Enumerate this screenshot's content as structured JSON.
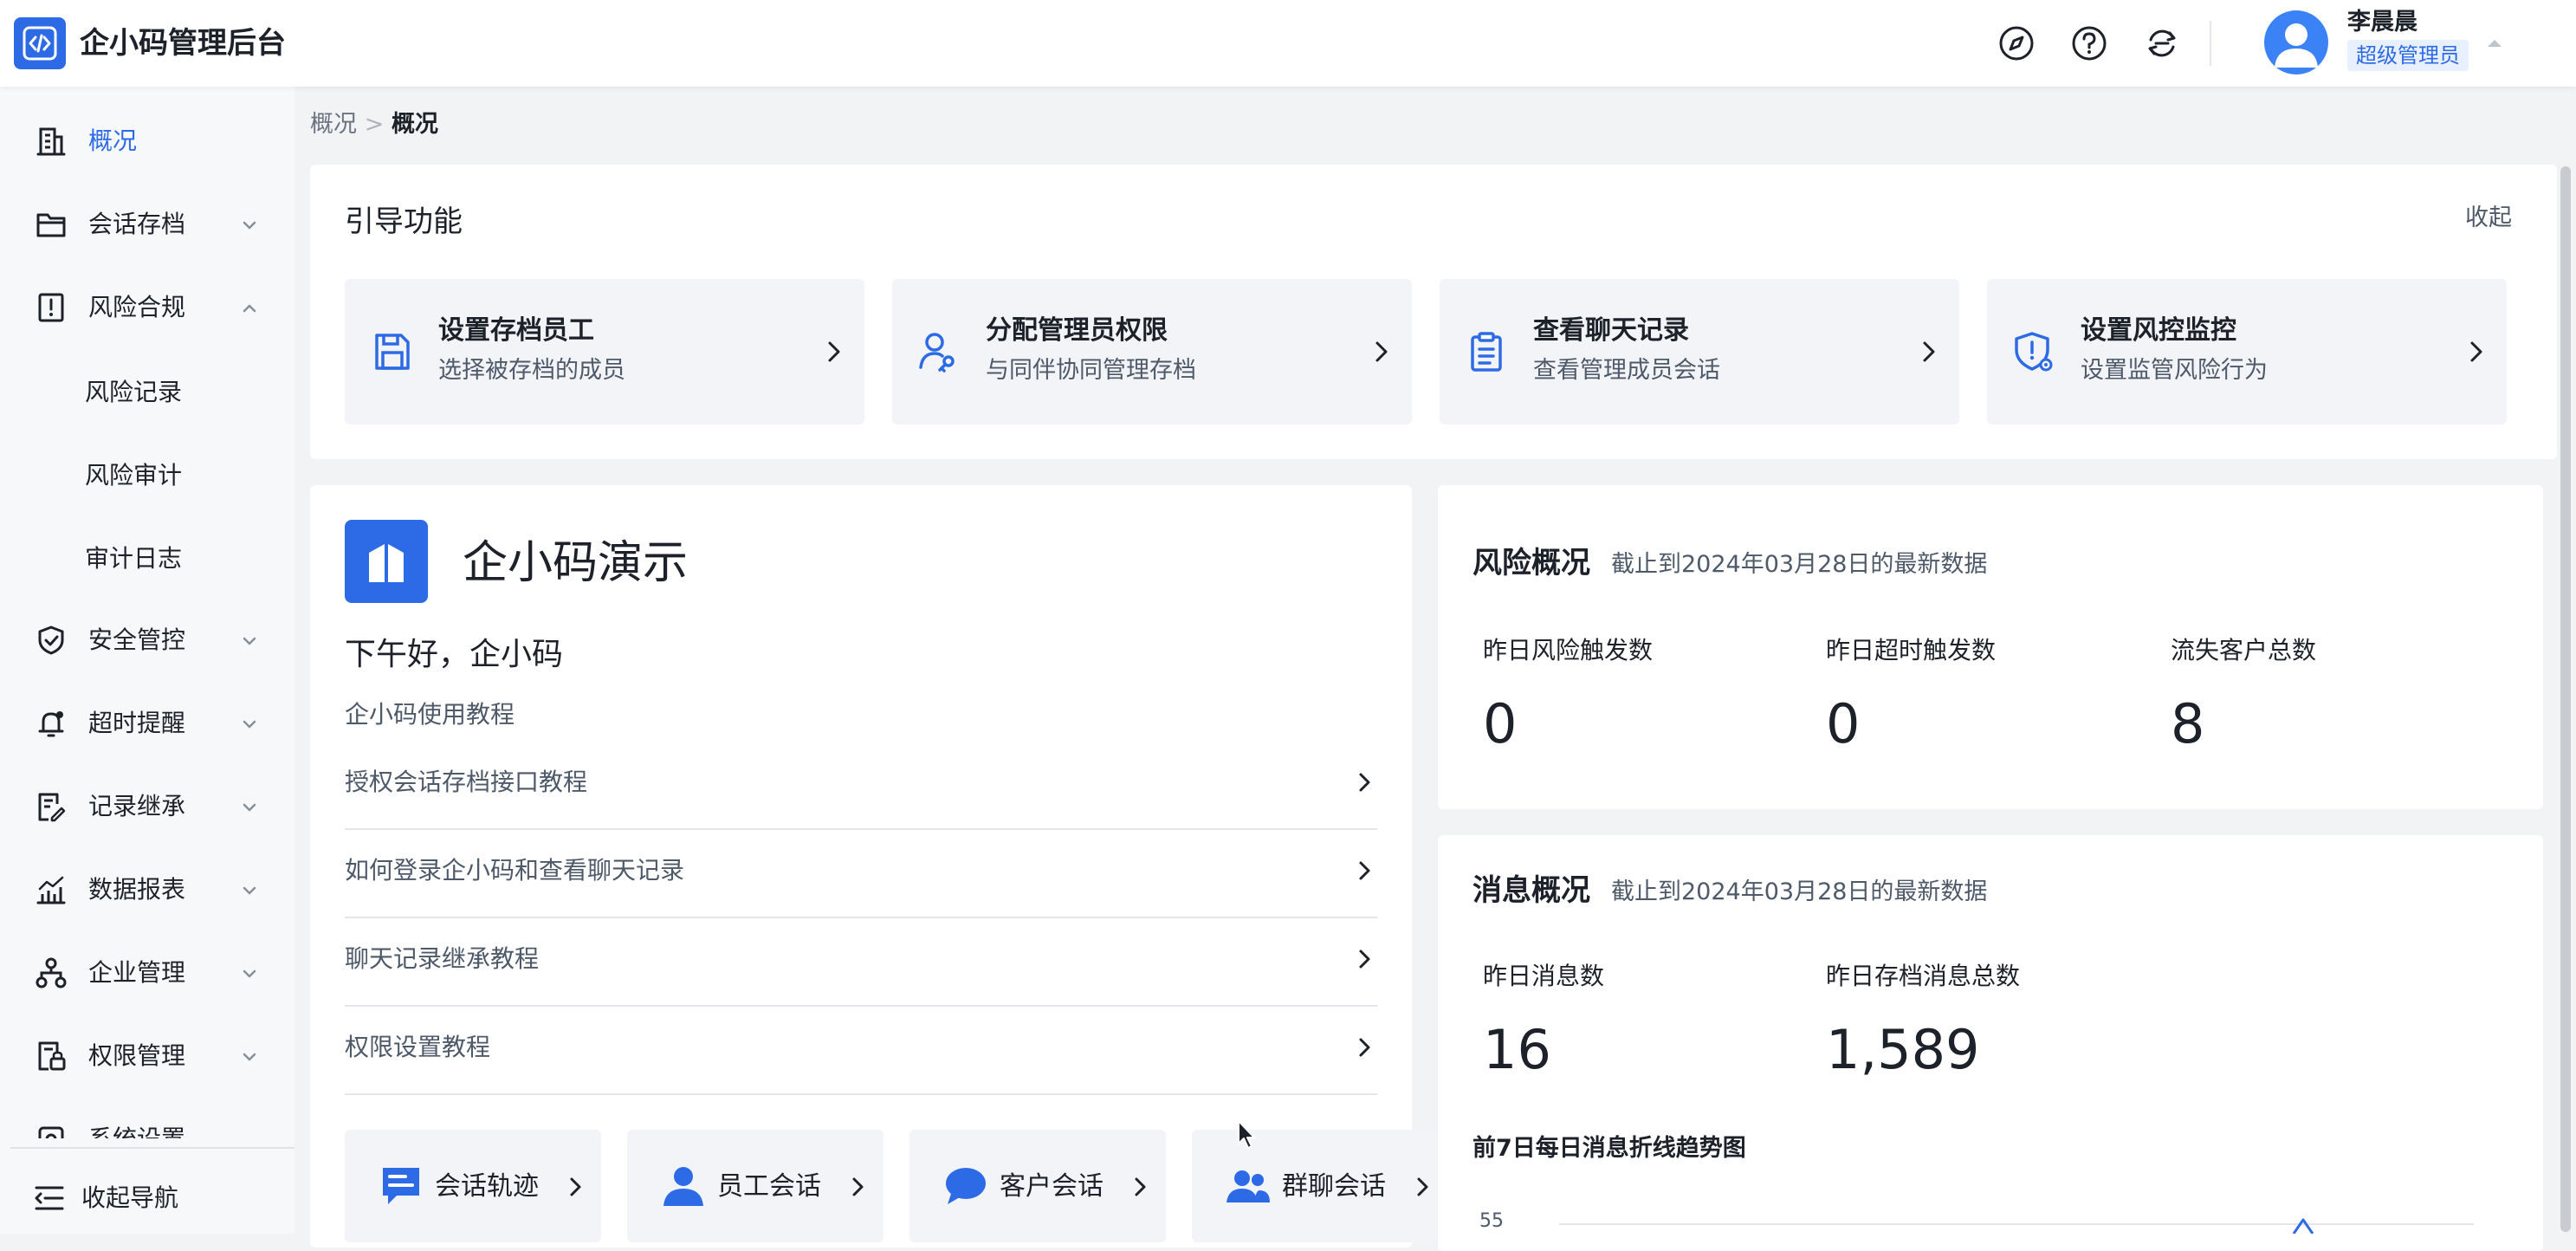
{
  "app": {
    "title": "企小码管理后台",
    "logo_icon": "code-brackets-icon"
  },
  "colors": {
    "primary": "#2d6be6",
    "page_bg": "#f2f3f5",
    "sidebar_bg": "#f7f8fa",
    "tile_bg": "#f2f4f7",
    "text": "#1d2129",
    "muted_text": "#4e5969"
  },
  "header": {
    "icons": [
      "compass-icon",
      "help-icon",
      "sync-icon"
    ],
    "user": {
      "name": "李晨晨",
      "role": "超级管理员"
    }
  },
  "sidebar": {
    "items": [
      {
        "label": "概况",
        "icon": "building-icon",
        "active": true
      },
      {
        "label": "会话存档",
        "icon": "folder-icon",
        "expandable": true
      },
      {
        "label": "风险合规",
        "icon": "alert-book-icon",
        "expanded": true,
        "children": [
          {
            "label": "风险记录"
          },
          {
            "label": "风险审计"
          },
          {
            "label": "审计日志"
          }
        ]
      },
      {
        "label": "安全管控",
        "icon": "shield-check-icon",
        "expandable": true
      },
      {
        "label": "超时提醒",
        "icon": "alarm-bell-icon",
        "expandable": true
      },
      {
        "label": "记录继承",
        "icon": "record-edit-icon",
        "expandable": true
      },
      {
        "label": "数据报表",
        "icon": "bar-chart-icon",
        "expandable": true
      },
      {
        "label": "企业管理",
        "icon": "org-tree-icon",
        "expandable": true
      },
      {
        "label": "权限管理",
        "icon": "permission-lock-icon",
        "expandable": true
      },
      {
        "label": "系统设置",
        "icon": "settings-icon",
        "expandable": true
      }
    ],
    "collapse_label": "收起导航"
  },
  "breadcrumb": [
    "概况",
    "概况"
  ],
  "guide": {
    "title": "引导功能",
    "collapse_label": "收起",
    "tiles": [
      {
        "title": "设置存档员工",
        "subtitle": "选择被存档的成员",
        "icon": "save-disk-icon"
      },
      {
        "title": "分配管理员权限",
        "subtitle": "与同伴协同管理存档",
        "icon": "user-key-icon"
      },
      {
        "title": "查看聊天记录",
        "subtitle": "查看管理成员会话",
        "icon": "clipboard-icon"
      },
      {
        "title": "设置风控监控",
        "subtitle": "设置监管风险行为",
        "icon": "shield-alert-icon"
      }
    ]
  },
  "org": {
    "name": "企小码演示",
    "greeting": "下午好，企小码",
    "tutorial_title": "企小码使用教程",
    "tutorials": [
      "授权会话存档接口教程",
      "如何登录企小码和查看聊天记录",
      "聊天记录继承教程",
      "权限设置教程"
    ],
    "quick_links": [
      {
        "label": "会话轨迹",
        "icon": "chat-track-icon"
      },
      {
        "label": "员工会话",
        "icon": "employee-icon"
      },
      {
        "label": "客户会话",
        "icon": "chat-bubble-icon"
      },
      {
        "label": "群聊会话",
        "icon": "group-users-icon"
      }
    ]
  },
  "risk": {
    "title": "风险概况",
    "note": "截止到2024年03月28日的最新数据",
    "stats": [
      {
        "label": "昨日风险触发数",
        "value": "0"
      },
      {
        "label": "昨日超时触发数",
        "value": "0"
      },
      {
        "label": "流失客户总数",
        "value": "8"
      }
    ]
  },
  "messages": {
    "title": "消息概况",
    "note": "截止到2024年03月28日的最新数据",
    "stats": [
      {
        "label": "昨日消息数",
        "value": "16"
      },
      {
        "label": "昨日存档消息总数",
        "value": "1,589"
      }
    ],
    "trend_title": "前7日每日消息折线趋势图",
    "trend_axis_top": "55"
  }
}
